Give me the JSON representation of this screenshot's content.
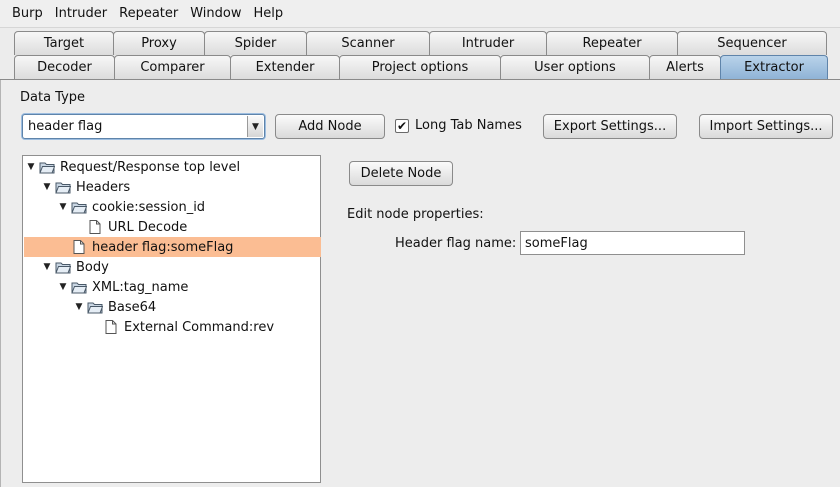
{
  "menu": [
    "Burp",
    "Intruder",
    "Repeater",
    "Window",
    "Help"
  ],
  "tabs_row1": [
    "Target",
    "Proxy",
    "Spider",
    "Scanner",
    "Intruder",
    "Repeater",
    "Sequencer"
  ],
  "tabs_row2": [
    "Decoder",
    "Comparer",
    "Extender",
    "Project options",
    "User options",
    "Alerts",
    "Extractor"
  ],
  "active_tab": "Extractor",
  "data_type_label": "Data Type",
  "data_type_value": "header flag",
  "add_node_label": "Add Node",
  "long_tab_names": {
    "label": "Long Tab Names",
    "checked": true
  },
  "export_label": "Export Settings...",
  "import_label": "Import Settings...",
  "tree": [
    {
      "label": "Request/Response top level",
      "type": "folder",
      "expanded": true,
      "selected": false
    },
    {
      "label": "Headers",
      "type": "folder",
      "expanded": true,
      "selected": false
    },
    {
      "label": "cookie:session_id",
      "type": "folder",
      "expanded": true,
      "selected": false
    },
    {
      "label": "URL Decode",
      "type": "leaf",
      "expanded": false,
      "selected": false
    },
    {
      "label": "header flag:someFlag",
      "type": "leaf",
      "expanded": false,
      "selected": true
    },
    {
      "label": "Body",
      "type": "folder",
      "expanded": true,
      "selected": false
    },
    {
      "label": "XML:tag_name",
      "type": "folder",
      "expanded": true,
      "selected": false
    },
    {
      "label": "Base64",
      "type": "folder",
      "expanded": true,
      "selected": false
    },
    {
      "label": "External Command:rev",
      "type": "leaf",
      "expanded": false,
      "selected": false
    }
  ],
  "delete_node_label": "Delete Node",
  "edit_props_label": "Edit node properties:",
  "header_flag_name_label": "Header flag name:",
  "header_flag_name_value": "someFlag",
  "colors": {
    "selected_row": "#fbbd93",
    "active_tab": "#9fc0e0"
  }
}
